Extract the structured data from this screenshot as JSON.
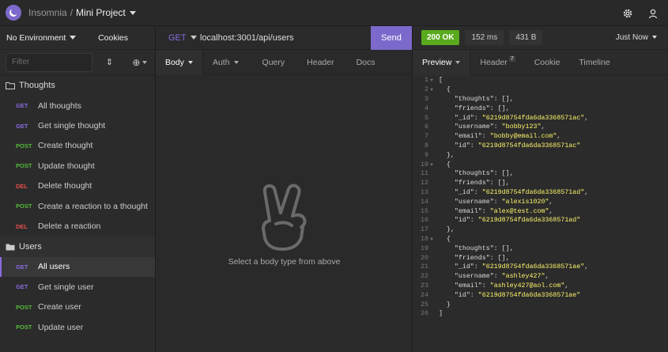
{
  "app": {
    "name": "Insomnia",
    "separator": "/",
    "project": "Mini Project"
  },
  "sidebar": {
    "environment": "No Environment",
    "cookies": "Cookies",
    "filter_placeholder": "Filter",
    "folders": [
      {
        "name": "Thoughts",
        "requests": [
          {
            "method": "GET",
            "name": "All thoughts"
          },
          {
            "method": "GET",
            "name": "Get single thought"
          },
          {
            "method": "POST",
            "name": "Create thought"
          },
          {
            "method": "POST",
            "name": "Update thought"
          },
          {
            "method": "DEL",
            "name": "Delete thought"
          },
          {
            "method": "POST",
            "name": "Create a reaction to a thought"
          },
          {
            "method": "DEL",
            "name": "Delete a reaction"
          }
        ]
      },
      {
        "name": "Users",
        "requests": [
          {
            "method": "GET",
            "name": "All users"
          },
          {
            "method": "GET",
            "name": "Get single user"
          },
          {
            "method": "POST",
            "name": "Create user"
          },
          {
            "method": "POST",
            "name": "Update user"
          }
        ]
      }
    ]
  },
  "request": {
    "method": "GET",
    "url": "localhost:3001/api/users",
    "send_label": "Send",
    "tabs": [
      "Body",
      "Auth",
      "Query",
      "Header",
      "Docs"
    ],
    "empty_body_text": "Select a body type from above"
  },
  "response": {
    "status": "200 OK",
    "time": "152 ms",
    "size": "431 B",
    "received": "Just Now",
    "tabs": {
      "preview": "Preview",
      "header": "Header",
      "header_count": "7",
      "cookie": "Cookie",
      "timeline": "Timeline"
    },
    "lines": [
      "[",
      "  {",
      "    \"thoughts\": [],",
      "    \"friends\": [],",
      "    \"_id\": \"6219d8754fda6da3368571ac\",",
      "    \"username\": \"bobby123\",",
      "    \"email\": \"bobby@email.com\",",
      "    \"id\": \"6219d8754fda6da3368571ac\"",
      "  },",
      "  {",
      "    \"thoughts\": [],",
      "    \"friends\": [],",
      "    \"_id\": \"6219d8754fda6da3368571ad\",",
      "    \"username\": \"alexis1020\",",
      "    \"email\": \"alex@test.com\",",
      "    \"id\": \"6219d8754fda6da3368571ad\"",
      "  },",
      "  {",
      "    \"thoughts\": [],",
      "    \"friends\": [],",
      "    \"_id\": \"6219d8754fda6da3368571ae\",",
      "    \"username\": \"ashley427\",",
      "    \"email\": \"ashley427@aol.com\",",
      "    \"id\": \"6219d8754fda6da3368571ae\"",
      "  }",
      "]"
    ],
    "fold_lines": [
      1,
      2,
      10,
      18
    ]
  },
  "colors": {
    "accent": "#7d69cb",
    "ok": "#5aaa1e",
    "get": "#8a6be0",
    "post": "#56b93a",
    "del": "#e54d4d",
    "string": "#fcf36a"
  }
}
